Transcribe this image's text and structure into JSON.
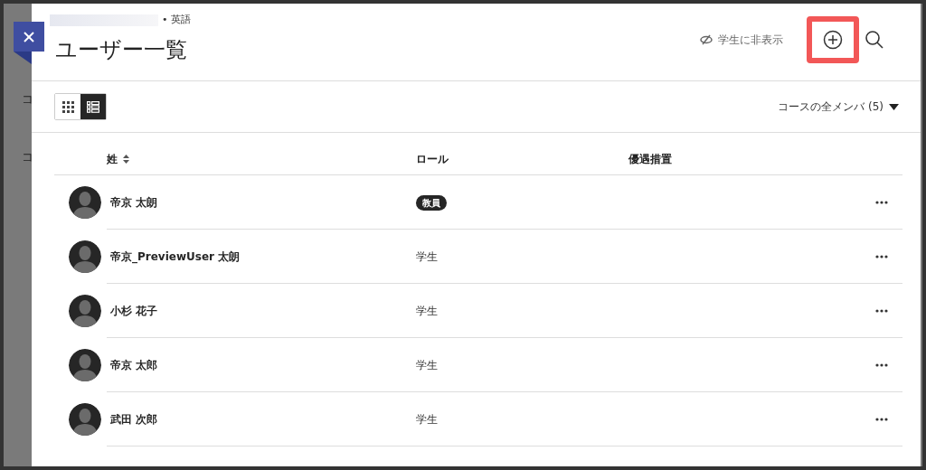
{
  "background": {
    "items": [
      "コ",
      "コ"
    ]
  },
  "header": {
    "breadcrumb": "• 英語",
    "title": "ユーザー一覧",
    "visibility": "学生に非表示",
    "highlight_add": true
  },
  "view_toggle": [
    {
      "kind": "grid",
      "selected": false
    },
    {
      "kind": "list",
      "selected": true
    }
  ],
  "filter": "コースの全メンバ (5)",
  "table": {
    "columns": [
      "姓",
      "ロール",
      "優遇措置"
    ],
    "rows": [
      {
        "name": "帝京 太朗",
        "role": "教員",
        "kind": "badge"
      },
      {
        "name": "帝京_PreviewUser 太朗",
        "role": "学生",
        "kind": "text"
      },
      {
        "name": "小杉 花子",
        "role": "学生",
        "kind": "text"
      },
      {
        "name": "帝京 太郎",
        "role": "学生",
        "kind": "text"
      },
      {
        "name": "武田 次郎",
        "role": "学生",
        "kind": "text"
      }
    ]
  }
}
